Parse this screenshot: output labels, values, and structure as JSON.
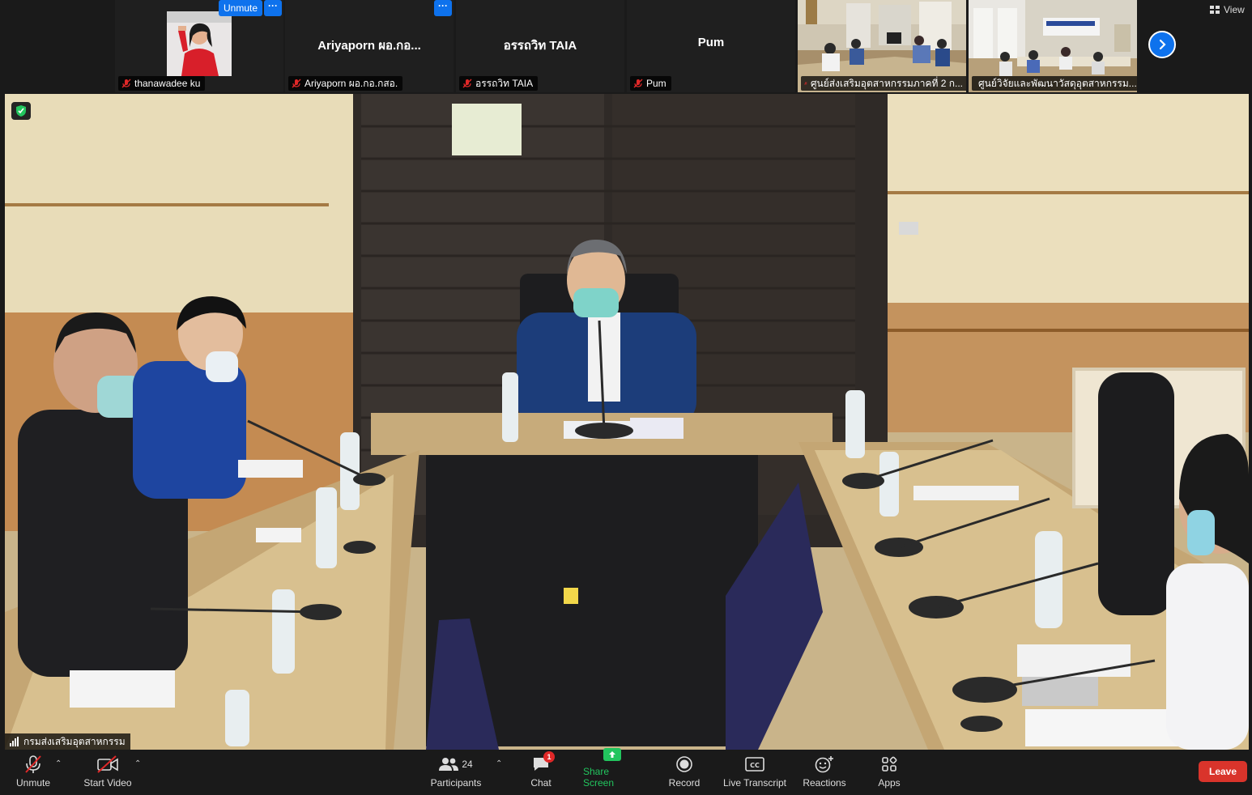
{
  "top_strip": {
    "unmute_pill": "Unmute",
    "tiles": [
      {
        "name_overlay": "",
        "label": "thanawadee ku"
      },
      {
        "name_overlay": "Ariyaporn ผอ.กอ...",
        "label": "Ariyaporn ผอ.กอ.กสอ."
      },
      {
        "name_overlay": "อรรถวิท TAIA",
        "label": "อรรถวิท TAIA"
      },
      {
        "name_overlay": "Pum",
        "label": "Pum"
      },
      {
        "name_overlay": "",
        "label": "ศูนย์ส่งเสริมอุตสาหกรรมภาคที่ 2 ก..."
      },
      {
        "name_overlay": "",
        "label": "ศูนย์วิจัยและพัฒนาวัสดุอุตสาหกรรม..."
      }
    ],
    "more_menu": "···",
    "view_label": "View"
  },
  "main_video": {
    "speaker_label": "กรมส่งเสริมอุตสาหกรรม"
  },
  "toolbar": {
    "unmute": "Unmute",
    "start_video": "Start Video",
    "participants": "Participants",
    "participants_count": "24",
    "chat": "Chat",
    "chat_badge": "1",
    "share_screen": "Share Screen",
    "record": "Record",
    "live_transcript": "Live Transcript",
    "reactions": "Reactions",
    "apps": "Apps",
    "leave": "Leave"
  },
  "colors": {
    "accent": "#0e72ed",
    "share_green": "#22c55e",
    "leave_red": "#d9342b",
    "muted_red": "#e02828"
  }
}
